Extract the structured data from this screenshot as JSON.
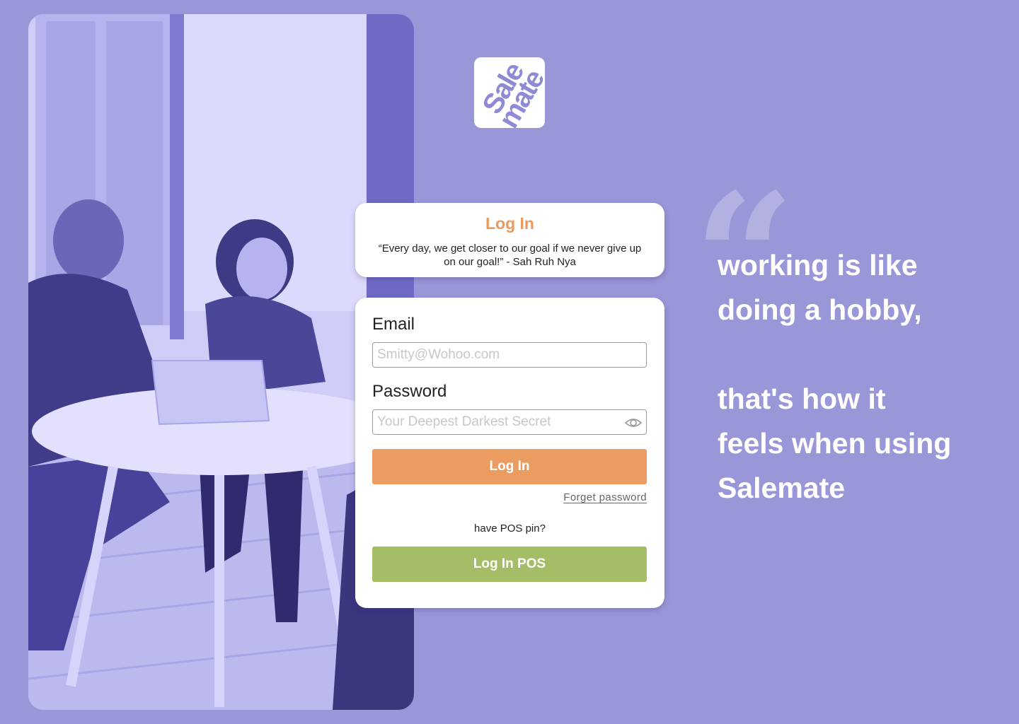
{
  "logo": {
    "line1": "Sale",
    "line2": "mate"
  },
  "header_card": {
    "title": "Log In",
    "quote": "“Every day, we get closer to our goal if we never give up on our goal!” - Sah Ruh Nya"
  },
  "form": {
    "email_label": "Email",
    "email_placeholder": "Smitty@Wohoo.com",
    "password_label": "Password",
    "password_placeholder": "Your Deepest Darkest Secret",
    "password_toggle_icon": "eye-icon",
    "login_button": "Log In",
    "forget_password": "Forget password",
    "pos_question": "have POS pin?",
    "pos_button": "Log In POS"
  },
  "side_quote": {
    "mark": "“",
    "line1": "working is like",
    "line2": "doing a hobby,",
    "line3": "that's how it",
    "line4": "feels when using",
    "line5": "Salemate"
  },
  "colors": {
    "background": "#9a97d8",
    "accent_orange": "#eb9c60",
    "accent_green": "#a5bd66",
    "brand_purple": "#8e8ad4"
  }
}
